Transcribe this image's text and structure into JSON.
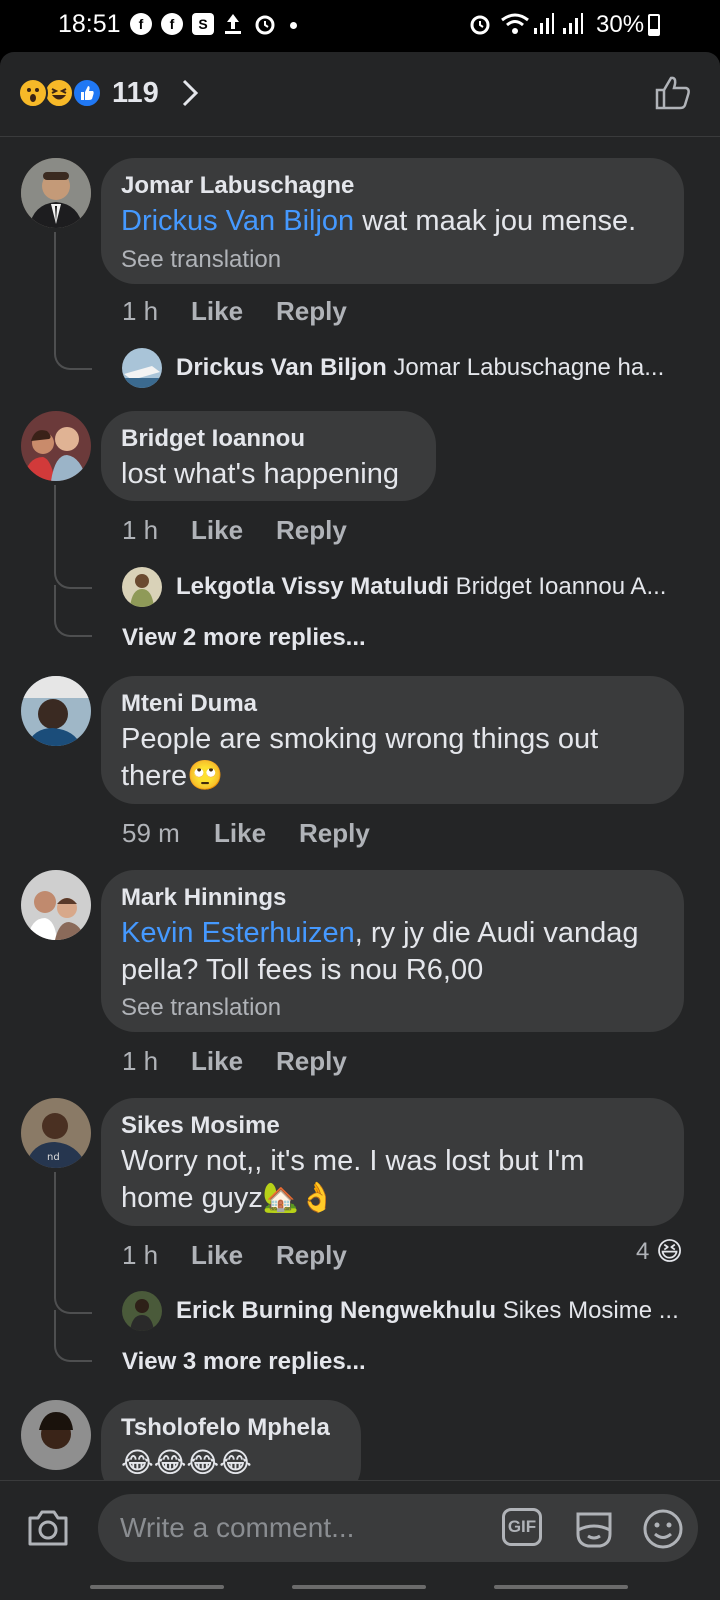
{
  "status_bar": {
    "time": "18:51",
    "battery": "30%",
    "battery_level": 0.3,
    "left_icons": [
      "facebook-icon",
      "facebook-icon",
      "s-app-icon",
      "upload-icon",
      "alarm-icon",
      "dot-icon"
    ],
    "right_icons": [
      "alarm-icon",
      "wifi-icon",
      "signal-icon",
      "signal-icon",
      "battery-icon"
    ]
  },
  "reactions": {
    "count": "119",
    "types": [
      "wow",
      "haha",
      "like"
    ],
    "colors": {
      "wow": "#f7b928",
      "haha": "#f7b928",
      "like": "#2078f4"
    }
  },
  "comments": [
    {
      "author": "Jomar Labuschagne",
      "mention": "Drickus Van Biljon",
      "text": " wat maak jou mense.",
      "see_translation": "See translation",
      "time": "1 h",
      "like": "Like",
      "reply": "Reply",
      "replies": [
        {
          "author": "Drickus Van Biljon",
          "preview": "Jomar Labuschagne ha..."
        }
      ]
    },
    {
      "author": "Bridget Ioannou",
      "text": "lost what's happening",
      "time": "1 h",
      "like": "Like",
      "reply": "Reply",
      "replies": [
        {
          "author": "Lekgotla Vissy Matuludi",
          "preview": "Bridget Ioannou A..."
        }
      ],
      "view_more": "View 2 more replies..."
    },
    {
      "author": "Mteni Duma",
      "text_line1": "People are smoking wrong things out",
      "text_line2": "there🙄",
      "time": "59 m",
      "like": "Like",
      "reply": "Reply"
    },
    {
      "author": "Mark Hinnings",
      "mention": "Kevin Esterhuizen",
      "text_line1": ", ry jy die Audi vandag",
      "text_line2": "pella? Toll fees is nou R6,00",
      "see_translation": "See translation",
      "time": "1 h",
      "like": "Like",
      "reply": "Reply"
    },
    {
      "author": "Sikes Mosime",
      "text_line1": "Worry not,, it's me. I was lost but I'm",
      "text_line2": "home guyz🏡👌",
      "time": "1 h",
      "like": "Like",
      "reply": "Reply",
      "reaction_count": "4",
      "reaction_emoji": "😆",
      "replies": [
        {
          "author": "Erick Burning Nengwekhulu",
          "preview": "Sikes Mosime ..."
        }
      ],
      "view_more": "View 3 more replies..."
    },
    {
      "author": "Tsholofelo Mphela"
    }
  ],
  "composer": {
    "placeholder": "Write a comment...",
    "gif_label": "GIF"
  }
}
